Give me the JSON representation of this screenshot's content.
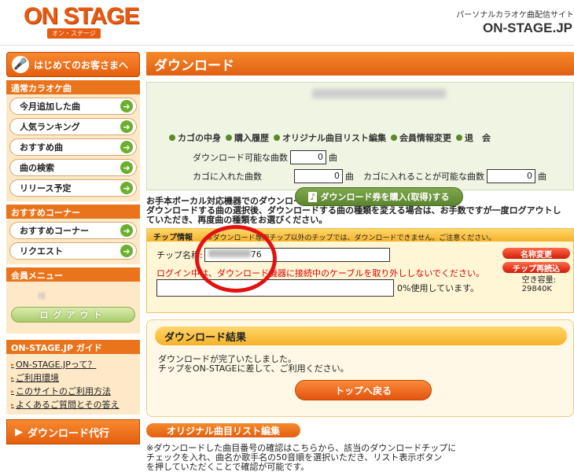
{
  "header": {
    "logo": "ON STAGE",
    "logo_sub": "オン・ステージ",
    "tagline": "パーソナルカラオケ曲配信サイト",
    "site": "ON-STAGE.JP"
  },
  "sidebar": {
    "first_visit": "はじめてのお客さまへ",
    "karaoke_head": "通常カラオケ曲",
    "karaoke_items": [
      "今月追加した曲",
      "人気ランキング",
      "おすすめ曲",
      "曲の検索",
      "リリース予定"
    ],
    "recommend_head": "おすすめコーナー",
    "recommend_items": [
      "おすすめコーナー",
      "リクエスト"
    ],
    "member_head": "会員メニュー",
    "member_name_blurred": "様",
    "logout": "ログアウト",
    "guide_head": "ON-STAGE.JP ガイド",
    "guide_links": [
      "ON-STAGE.JPって？",
      "ご利用環境",
      "このサイトのご利用方法",
      "よくあるご質問とその答え"
    ],
    "download_proxy": "ダウンロード代行"
  },
  "main": {
    "title": "ダウンロード",
    "nav": [
      "カゴの中身",
      "購入履歴",
      "オリジナル曲目リスト編集",
      "会員情報変更",
      "退　会"
    ],
    "downloadable_label": "ダウンロード可能な曲数",
    "downloadable_value": "0",
    "unit": "曲",
    "in_cart_label": "カゴに入れた曲数",
    "in_cart_value": "0",
    "can_add_label": "カゴに入れることが可能な曲数",
    "can_add_value": "0",
    "buy_ticket": "ダウンロード券を購入(取得)する",
    "notice_line1": "お手本ボーカル対応機器でのダウンロードをされるお客様へ",
    "notice_line2": "ダウンロードする曲の選択後、ダウンロードする曲の種類を変える場合は、お手数ですが一度ログアウトし",
    "notice_line3": "ていただき、再度曲の種類をお選びください。",
    "chip_head": "チップ情報",
    "chip_warn": "※ダウンロード専用チップ以外のチップでは、ダウンロードできません。ご注意ください。",
    "chip_name_label": "チップ名称:",
    "chip_name_value": "76",
    "rename_btn": "名称変更",
    "reread_btn": "チップ再読込",
    "cable_warning": "ログイン中は、ダウンロード機器に接続中のケーブルを取り外ししないでください。",
    "usage": "0%使用しています。",
    "capacity_label": "空き容量:",
    "capacity_value": "29840K",
    "result_title": "ダウンロード結果",
    "result_line1": "ダウンロードが完了いたしました。",
    "result_line2": "チップをON-STAGEに差して、ご利用ください。",
    "top_back": "トップへ戻る",
    "original_list": "オリジナル曲目リスト編集",
    "orig_line1": "※ダウンロードした曲目番号の確認はこちらから、該当のダウンロードチップに",
    "orig_line2": "チェックを入れ、曲名か歌手名の50音順を選択いただき、リスト表示ボタン",
    "orig_line3": "を押していただくことで確認が可能です。"
  },
  "colors": {
    "accent": "#e9741c",
    "panel_green": "#f0f5e3",
    "arrow_green": "#6bb02c",
    "annotation_red": "#e21212"
  }
}
